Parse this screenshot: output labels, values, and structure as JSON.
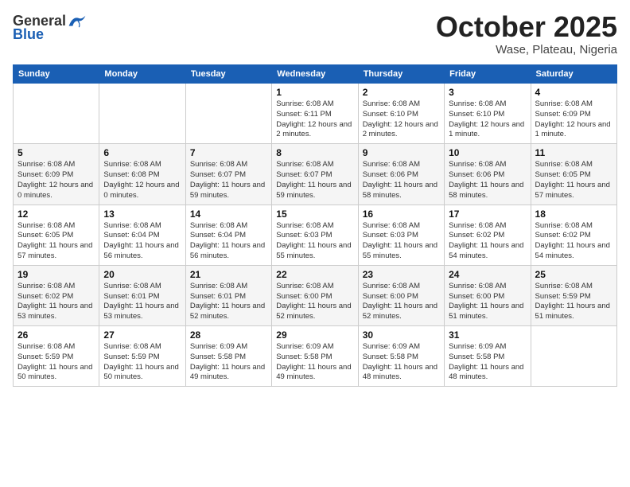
{
  "header": {
    "logo": {
      "general": "General",
      "blue": "Blue"
    },
    "month": "October 2025",
    "location": "Wase, Plateau, Nigeria"
  },
  "weekdays": [
    "Sunday",
    "Monday",
    "Tuesday",
    "Wednesday",
    "Thursday",
    "Friday",
    "Saturday"
  ],
  "weeks": [
    [
      {
        "day": "",
        "info": ""
      },
      {
        "day": "",
        "info": ""
      },
      {
        "day": "",
        "info": ""
      },
      {
        "day": "1",
        "info": "Sunrise: 6:08 AM\nSunset: 6:11 PM\nDaylight: 12 hours and 2 minutes."
      },
      {
        "day": "2",
        "info": "Sunrise: 6:08 AM\nSunset: 6:10 PM\nDaylight: 12 hours and 2 minutes."
      },
      {
        "day": "3",
        "info": "Sunrise: 6:08 AM\nSunset: 6:10 PM\nDaylight: 12 hours and 1 minute."
      },
      {
        "day": "4",
        "info": "Sunrise: 6:08 AM\nSunset: 6:09 PM\nDaylight: 12 hours and 1 minute."
      }
    ],
    [
      {
        "day": "5",
        "info": "Sunrise: 6:08 AM\nSunset: 6:09 PM\nDaylight: 12 hours and 0 minutes."
      },
      {
        "day": "6",
        "info": "Sunrise: 6:08 AM\nSunset: 6:08 PM\nDaylight: 12 hours and 0 minutes."
      },
      {
        "day": "7",
        "info": "Sunrise: 6:08 AM\nSunset: 6:07 PM\nDaylight: 11 hours and 59 minutes."
      },
      {
        "day": "8",
        "info": "Sunrise: 6:08 AM\nSunset: 6:07 PM\nDaylight: 11 hours and 59 minutes."
      },
      {
        "day": "9",
        "info": "Sunrise: 6:08 AM\nSunset: 6:06 PM\nDaylight: 11 hours and 58 minutes."
      },
      {
        "day": "10",
        "info": "Sunrise: 6:08 AM\nSunset: 6:06 PM\nDaylight: 11 hours and 58 minutes."
      },
      {
        "day": "11",
        "info": "Sunrise: 6:08 AM\nSunset: 6:05 PM\nDaylight: 11 hours and 57 minutes."
      }
    ],
    [
      {
        "day": "12",
        "info": "Sunrise: 6:08 AM\nSunset: 6:05 PM\nDaylight: 11 hours and 57 minutes."
      },
      {
        "day": "13",
        "info": "Sunrise: 6:08 AM\nSunset: 6:04 PM\nDaylight: 11 hours and 56 minutes."
      },
      {
        "day": "14",
        "info": "Sunrise: 6:08 AM\nSunset: 6:04 PM\nDaylight: 11 hours and 56 minutes."
      },
      {
        "day": "15",
        "info": "Sunrise: 6:08 AM\nSunset: 6:03 PM\nDaylight: 11 hours and 55 minutes."
      },
      {
        "day": "16",
        "info": "Sunrise: 6:08 AM\nSunset: 6:03 PM\nDaylight: 11 hours and 55 minutes."
      },
      {
        "day": "17",
        "info": "Sunrise: 6:08 AM\nSunset: 6:02 PM\nDaylight: 11 hours and 54 minutes."
      },
      {
        "day": "18",
        "info": "Sunrise: 6:08 AM\nSunset: 6:02 PM\nDaylight: 11 hours and 54 minutes."
      }
    ],
    [
      {
        "day": "19",
        "info": "Sunrise: 6:08 AM\nSunset: 6:02 PM\nDaylight: 11 hours and 53 minutes."
      },
      {
        "day": "20",
        "info": "Sunrise: 6:08 AM\nSunset: 6:01 PM\nDaylight: 11 hours and 53 minutes."
      },
      {
        "day": "21",
        "info": "Sunrise: 6:08 AM\nSunset: 6:01 PM\nDaylight: 11 hours and 52 minutes."
      },
      {
        "day": "22",
        "info": "Sunrise: 6:08 AM\nSunset: 6:00 PM\nDaylight: 11 hours and 52 minutes."
      },
      {
        "day": "23",
        "info": "Sunrise: 6:08 AM\nSunset: 6:00 PM\nDaylight: 11 hours and 52 minutes."
      },
      {
        "day": "24",
        "info": "Sunrise: 6:08 AM\nSunset: 6:00 PM\nDaylight: 11 hours and 51 minutes."
      },
      {
        "day": "25",
        "info": "Sunrise: 6:08 AM\nSunset: 5:59 PM\nDaylight: 11 hours and 51 minutes."
      }
    ],
    [
      {
        "day": "26",
        "info": "Sunrise: 6:08 AM\nSunset: 5:59 PM\nDaylight: 11 hours and 50 minutes."
      },
      {
        "day": "27",
        "info": "Sunrise: 6:08 AM\nSunset: 5:59 PM\nDaylight: 11 hours and 50 minutes."
      },
      {
        "day": "28",
        "info": "Sunrise: 6:09 AM\nSunset: 5:58 PM\nDaylight: 11 hours and 49 minutes."
      },
      {
        "day": "29",
        "info": "Sunrise: 6:09 AM\nSunset: 5:58 PM\nDaylight: 11 hours and 49 minutes."
      },
      {
        "day": "30",
        "info": "Sunrise: 6:09 AM\nSunset: 5:58 PM\nDaylight: 11 hours and 48 minutes."
      },
      {
        "day": "31",
        "info": "Sunrise: 6:09 AM\nSunset: 5:58 PM\nDaylight: 11 hours and 48 minutes."
      },
      {
        "day": "",
        "info": ""
      }
    ]
  ]
}
